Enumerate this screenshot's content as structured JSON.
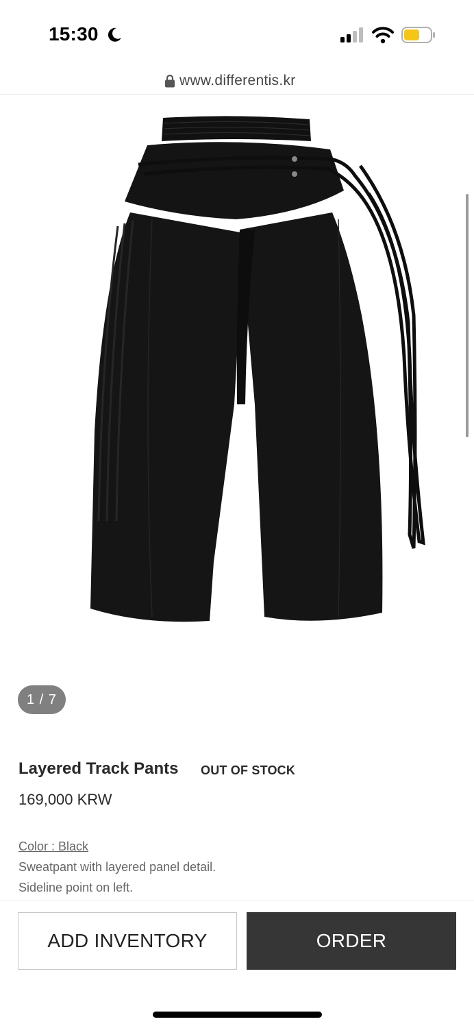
{
  "status_bar": {
    "time": "15:30",
    "icons": [
      "moon-icon",
      "cellular-signal-icon",
      "wifi-icon",
      "battery-icon"
    ],
    "battery_color": "#f5c518"
  },
  "browser": {
    "url": "www.differentis.kr",
    "icons": [
      "lock-icon"
    ]
  },
  "gallery": {
    "image": "black-layered-track-pants-photo",
    "pager": "1 / 7"
  },
  "product": {
    "title": "Layered Track Pants",
    "stock_badge": "OUT OF STOCK",
    "price": "169,000 KRW",
    "color_label": "Color : Black",
    "description": [
      "Sweatpant with layered panel detail.",
      "Sideline point on left."
    ]
  },
  "actions": {
    "add_inventory_label": "ADD INVENTORY",
    "order_label": "ORDER",
    "order_bg": "#363636"
  }
}
